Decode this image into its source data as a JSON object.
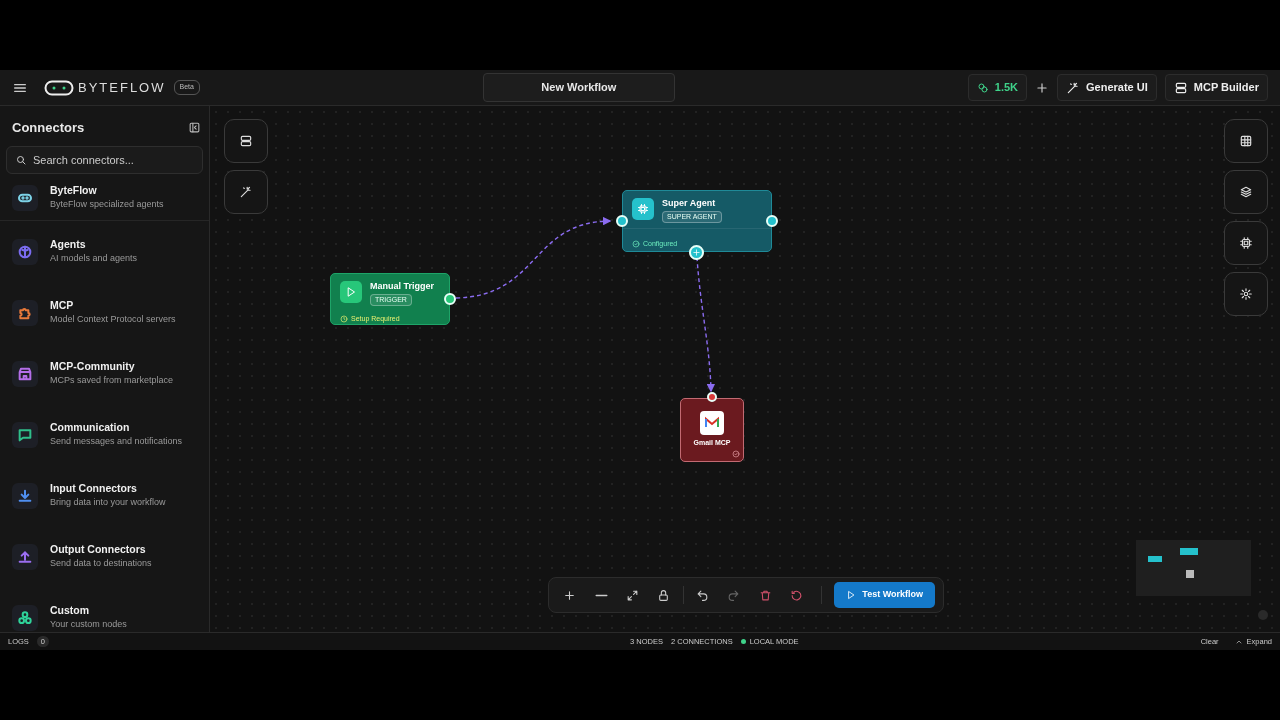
{
  "header": {
    "logo": "BYTEFLOW",
    "badge": "Beta",
    "workflow_title": "New Workflow",
    "credits": "1.5K",
    "buttons": [
      {
        "label": "Generate UI"
      },
      {
        "label": "MCP Builder"
      }
    ]
  },
  "sidebar": {
    "title": "Connectors",
    "search": {
      "placeholder": "Search connectors..."
    },
    "items": [
      {
        "title": "ByteFlow",
        "subtitle": "ByteFlow specialized agents",
        "color": "#7dd3e8"
      },
      {
        "title": "Agents",
        "subtitle": "AI models and agents",
        "color": "#7b6cf0"
      },
      {
        "title": "MCP",
        "subtitle": "Model Context Protocol servers",
        "color": "#e8793a"
      },
      {
        "title": "MCP-Community",
        "subtitle": "MCPs saved from marketplace",
        "color": "#b46ee8"
      },
      {
        "title": "Communication",
        "subtitle": "Send messages and notifications",
        "color": "#2fbf8a"
      },
      {
        "title": "Input Connectors",
        "subtitle": "Bring data into your workflow",
        "color": "#4f8ff0"
      },
      {
        "title": "Output Connectors",
        "subtitle": "Send data to destinations",
        "color": "#9a6ef0"
      },
      {
        "title": "Custom",
        "subtitle": "Your custom nodes",
        "color": "#2fd39a"
      }
    ]
  },
  "nodes": [
    {
      "kind": "trigger",
      "title": "Manual Trigger",
      "badge": "TRIGGER",
      "status": "Setup Required",
      "configured": false
    },
    {
      "kind": "agent",
      "title": "Super Agent",
      "badge": "SUPER AGENT",
      "status": "Configured",
      "configured": true
    },
    {
      "kind": "mcp",
      "title": "Gmail MCP",
      "configured": true
    }
  ],
  "toolbar": {
    "run_button": "Test Workflow"
  },
  "status_bar": {
    "logs_label": "LOGS",
    "logs_count": "0",
    "nodes": "3 NODES",
    "connections": "2 CONNECTIONS",
    "mode": "LOCAL MODE",
    "clear": "Clear",
    "expand": "Expand"
  }
}
